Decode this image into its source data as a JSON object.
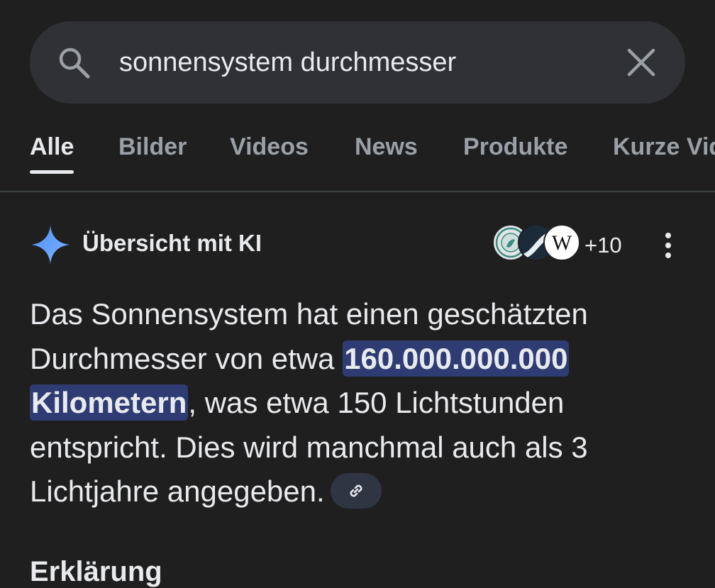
{
  "search": {
    "query": "sonnensystem durchmesser",
    "search_icon": "search-icon",
    "clear_icon": "close-icon"
  },
  "tabs": [
    {
      "label": "Alle",
      "active": true
    },
    {
      "label": "Bilder",
      "active": false
    },
    {
      "label": "Videos",
      "active": false
    },
    {
      "label": "News",
      "active": false
    },
    {
      "label": "Produkte",
      "active": false
    },
    {
      "label": "Kurze Vid",
      "active": false
    }
  ],
  "ai_overview": {
    "title": "Übersicht mit KI",
    "sparkle_icon": "sparkle-icon",
    "sources_count": "+10",
    "source_icons": [
      "max-planck-logo-icon",
      "source-logo-icon",
      "wikipedia-logo-icon"
    ],
    "more_icon": "more-vertical-icon",
    "answer": {
      "part1": "Das Sonnensystem hat einen geschätzten Durchmesser von etwa ",
      "highlight_line1": "160.000.000.000",
      "highlight_line2": "Kilometern",
      "part2": ", was etwa 150 Lichtstunden entspricht. Dies wird manchmal auch als 3 Lichtjahre angegeben."
    },
    "link_icon": "link-icon",
    "next_heading": "Erklärung"
  },
  "colors": {
    "background": "#1f1f1f",
    "search_bar": "#303134",
    "text_primary": "#e8eaed",
    "text_secondary": "#9aa0a6",
    "highlight": "#2e3c73",
    "sparkle": "#4a90f7"
  }
}
